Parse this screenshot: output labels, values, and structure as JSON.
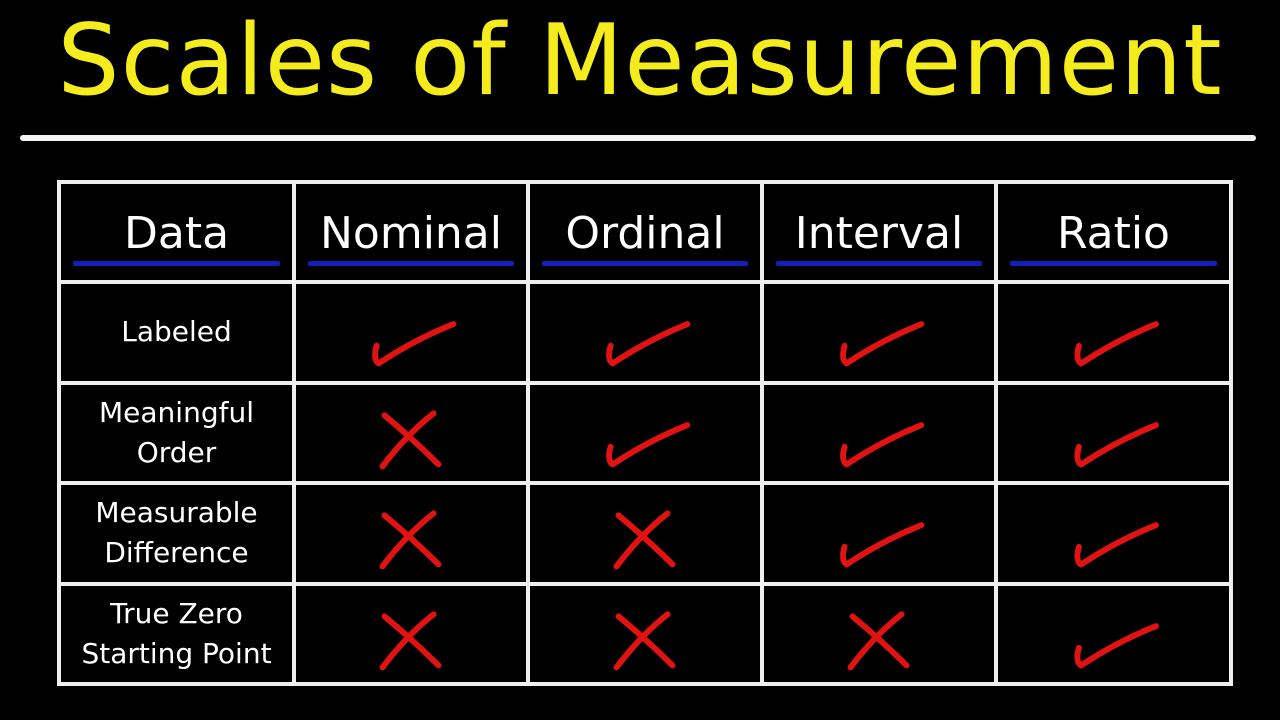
{
  "title": "Scales of Measurement",
  "colors": {
    "title": "#f4ec1c",
    "underline": "#1020b8",
    "mark": "#e01212",
    "grid": "#efefef",
    "background": "#000000"
  },
  "table": {
    "headers": [
      "Data",
      "Nominal",
      "Ordinal",
      "Interval",
      "Ratio"
    ],
    "rows": [
      {
        "label": "Labeled",
        "marks": [
          "check",
          "check",
          "check",
          "check"
        ]
      },
      {
        "label": "Meaningful\nOrder",
        "marks": [
          "cross",
          "check",
          "check",
          "check"
        ]
      },
      {
        "label": "Measurable\nDifference",
        "marks": [
          "cross",
          "cross",
          "check",
          "check"
        ]
      },
      {
        "label": "True Zero\nStarting Point",
        "marks": [
          "cross",
          "cross",
          "cross",
          "check"
        ]
      }
    ]
  }
}
